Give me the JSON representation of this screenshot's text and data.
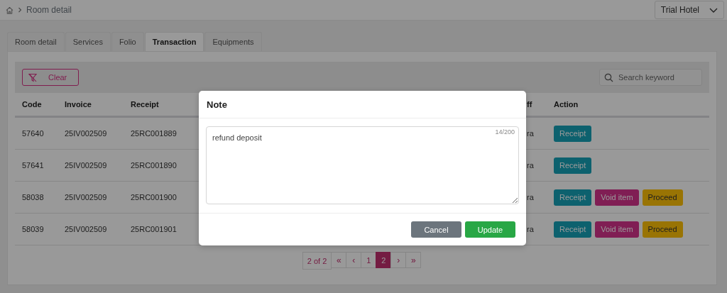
{
  "breadcrumb": {
    "current": "Room detail"
  },
  "hotel_selector": {
    "value": "Trial Hotel"
  },
  "tabs": [
    {
      "label": "Room detail",
      "selected": false
    },
    {
      "label": "Services",
      "selected": false
    },
    {
      "label": "Folio",
      "selected": false
    },
    {
      "label": "Transaction",
      "selected": true
    },
    {
      "label": "Equipments",
      "selected": false
    }
  ],
  "filter_bar": {
    "clear_button": "Clear",
    "search": {
      "placeholder": "Search keyword"
    }
  },
  "table": {
    "columns": [
      "Code",
      "Invoice",
      "Receipt",
      "ff",
      "Action"
    ],
    "rows": [
      {
        "cells": [
          "57640",
          "25IV002509",
          "25RC001889",
          "ra"
        ],
        "actions": [
          {
            "kind": "receipt",
            "label": "Receipt"
          }
        ]
      },
      {
        "cells": [
          "57641",
          "25IV002509",
          "25RC001890",
          "ra"
        ],
        "actions": [
          {
            "kind": "receipt",
            "label": "Receipt"
          }
        ]
      },
      {
        "cells": [
          "58038",
          "25IV002509",
          "25RC001900",
          "ra"
        ],
        "actions": [
          {
            "kind": "receipt",
            "label": "Receipt"
          },
          {
            "kind": "void",
            "label": "Void item"
          },
          {
            "kind": "proceed",
            "label": "Proceed"
          }
        ]
      },
      {
        "cells": [
          "58039",
          "25IV002509",
          "25RC001901",
          "ra"
        ],
        "actions": [
          {
            "kind": "receipt",
            "label": "Receipt"
          },
          {
            "kind": "void",
            "label": "Void item"
          },
          {
            "kind": "proceed",
            "label": "Proceed"
          }
        ]
      }
    ]
  },
  "pagination": {
    "summary": "2 of 2",
    "items": [
      {
        "kind": "first",
        "label": "«",
        "selected": false
      },
      {
        "kind": "prev",
        "label": "‹",
        "selected": false
      },
      {
        "kind": "page",
        "label": "1",
        "selected": false
      },
      {
        "kind": "page",
        "label": "2",
        "selected": true
      },
      {
        "kind": "next",
        "label": "›",
        "selected": false
      },
      {
        "kind": "last",
        "label": "»",
        "selected": false
      }
    ]
  },
  "modal": {
    "title": "Note",
    "note": {
      "value": "refund deposit",
      "counter": "14/200"
    },
    "buttons": [
      {
        "kind": "cancel",
        "label": "Cancel"
      },
      {
        "kind": "update",
        "label": "Update"
      }
    ]
  }
}
